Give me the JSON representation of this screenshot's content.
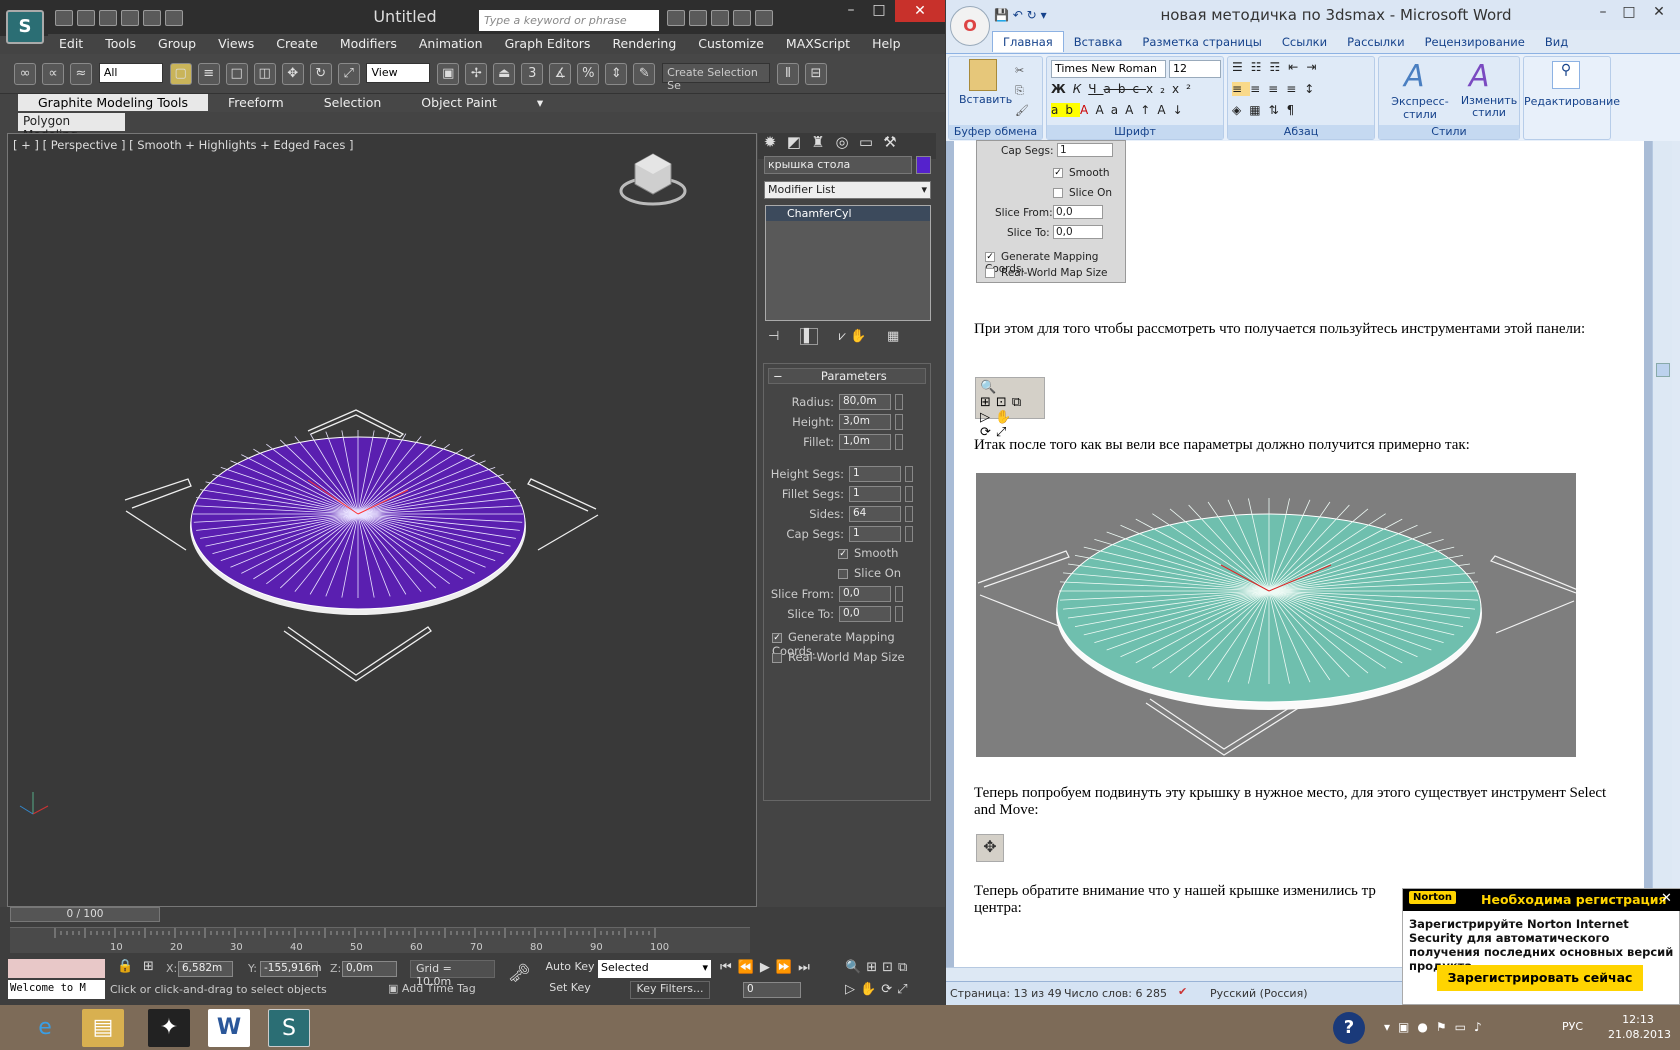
{
  "max": {
    "title": "Untitled",
    "search_placeholder": "Type a keyword or phrase",
    "menu": [
      "Edit",
      "Tools",
      "Group",
      "Views",
      "Create",
      "Modifiers",
      "Animation",
      "Graph Editors",
      "Rendering",
      "Customize",
      "MAXScript",
      "Help"
    ],
    "selection_filter": "All",
    "ref_coord": "View",
    "named_selection": "Create Selection Se",
    "ribbon_tabs": [
      "Graphite Modeling Tools",
      "Freeform",
      "Selection",
      "Object Paint"
    ],
    "ribbon_panel": "Polygon Modeling",
    "viewport_label": "[ + ] [ Perspective ] [ Smooth + Highlights + Edged Faces ]",
    "object_name": "крышка стола",
    "object_color": "#5522cc",
    "modifier_list": "Modifier List",
    "stack_item": "ChamferCyl",
    "rollout": "Parameters",
    "params": {
      "radius_label": "Radius:",
      "radius": "80,0m",
      "height_label": "Height:",
      "height": "3,0m",
      "fillet_label": "Fillet:",
      "fillet": "1,0m",
      "height_segs_label": "Height Segs:",
      "height_segs": "1",
      "fillet_segs_label": "Fillet Segs:",
      "fillet_segs": "1",
      "sides_label": "Sides:",
      "sides": "64",
      "cap_segs_label": "Cap Segs:",
      "cap_segs": "1",
      "smooth_label": "Smooth",
      "slice_on_label": "Slice On",
      "slice_from_label": "Slice From:",
      "slice_from": "0,0",
      "slice_to_label": "Slice To:",
      "slice_to": "0,0",
      "gen_map_label": "Generate Mapping Coords.",
      "real_world_label": "Real-World Map Size"
    },
    "time": {
      "slider": "0 / 100",
      "ticks": [
        "10",
        "20",
        "30",
        "40",
        "50",
        "60",
        "70",
        "80",
        "90",
        "100"
      ]
    },
    "status": {
      "listener": "Welcome to M",
      "x_label": "X:",
      "x": "6,582m",
      "y_label": "Y:",
      "y": "-155,916m",
      "z_label": "Z:",
      "z": "0,0m",
      "grid": "Grid = 10,0m",
      "prompt": "Click or click-and-drag to select objects",
      "add_time_tag": "Add Time Tag",
      "auto_key": "Auto Key",
      "set_key": "Set Key",
      "key_mode": "Selected",
      "key_filters": "Key Filters...",
      "frame": "0"
    },
    "mesh_color": "#5a1fb0"
  },
  "word": {
    "title": "новая методичка по 3dsmax - Microsoft Word",
    "tabs": [
      "Главная",
      "Вставка",
      "Разметка страницы",
      "Ссылки",
      "Рассылки",
      "Рецензирование",
      "Вид"
    ],
    "font": "Times New Roman",
    "font_size": "12",
    "groups": [
      "Буфер обмена",
      "Шрифт",
      "Абзац",
      "Стили"
    ],
    "paste": "Вставить",
    "style_express": "Экспресс-стили",
    "style_change": "Изменить стили",
    "editing": "Редактирование",
    "panel_shot": {
      "cap_segs_label": "Cap Segs:",
      "cap_segs": "1",
      "smooth": "Smooth",
      "slice_on": "Slice On",
      "slice_from_label": "Slice From:",
      "slice_from": "0,0",
      "slice_to_label": "Slice To:",
      "slice_to": "0,0",
      "gen_map": "Generate Mapping Coords.",
      "real_world": "Real-World Map Size"
    },
    "para1": "При этом для того чтобы рассмотреть что получается пользуйтесь инструментами этой панели:",
    "para2": "Итак после того как вы вели все параметры должно получится примерно так:",
    "para3": "Теперь попробуем подвинуть эту крышку в нужное место, для этого существует инструмент Select and Move:",
    "para4": "Теперь обратите внимание что у нашей крышке изменились тр",
    "para4b": "центра:",
    "status_page": "Страница: 13 из 49",
    "status_words": "Число слов: 6 285",
    "status_lang": "Русский (Россия)",
    "mesh_color": "#6fbfae"
  },
  "norton": {
    "brand": "Norton",
    "header": "Необходима регистрация",
    "body": "Зарегистрируйте Norton Internet Security для автоматического получения последних основных версий продукта.",
    "button": "Зарегистрировать сейчас"
  },
  "taskbar": {
    "lang": "РУС",
    "time": "12:13",
    "date": "21.08.2013"
  }
}
